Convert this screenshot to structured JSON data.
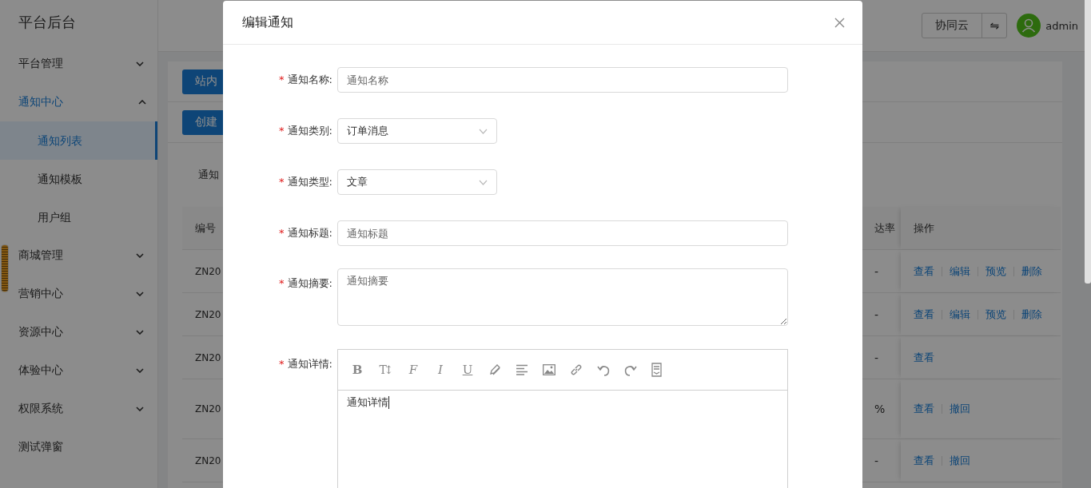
{
  "sidebar": {
    "title": "平台后台",
    "items": [
      {
        "label": "平台管理",
        "kind": "group",
        "selected": false,
        "expanded": false
      },
      {
        "label": "通知中心",
        "kind": "group",
        "selected": true,
        "expanded": true,
        "children": [
          {
            "label": "通知列表",
            "selected": true
          },
          {
            "label": "通知模板",
            "selected": false
          },
          {
            "label": "用户组",
            "selected": false
          }
        ]
      },
      {
        "label": "商城管理",
        "kind": "group",
        "selected": false,
        "expanded": false
      },
      {
        "label": "营销中心",
        "kind": "group",
        "selected": false,
        "expanded": false
      },
      {
        "label": "资源中心",
        "kind": "group",
        "selected": false,
        "expanded": false
      },
      {
        "label": "体验中心",
        "kind": "group",
        "selected": false,
        "expanded": false
      },
      {
        "label": "权限系统",
        "kind": "group",
        "selected": false,
        "expanded": false
      },
      {
        "label": "测试弹窗",
        "kind": "link",
        "selected": false
      }
    ]
  },
  "header": {
    "org": "协同云",
    "switch": "⇋",
    "user": "admin"
  },
  "toolbar": {
    "buttons": [
      "站内",
      "创建"
    ],
    "filter_label": "通知"
  },
  "table": {
    "columns": [
      "编号",
      "达率",
      "操作"
    ],
    "rows": [
      {
        "id": "ZN20",
        "rate": "-",
        "actions": [
          "查看",
          "编辑",
          "预览",
          "删除"
        ]
      },
      {
        "id": "ZN20",
        "rate": "-",
        "actions": [
          "查看",
          "编辑",
          "预览",
          "删除"
        ]
      },
      {
        "id": "ZN20",
        "rate": "-",
        "actions": [
          "查看"
        ]
      },
      {
        "id": "ZN20",
        "rate": "%",
        "actions": [
          "查看",
          "撤回"
        ]
      },
      {
        "id": "ZN20",
        "rate": "-",
        "actions": [
          "查看",
          "撤回"
        ]
      }
    ]
  },
  "modal": {
    "title": "编辑通知",
    "fields": [
      {
        "kind": "input",
        "required_mark": "*",
        "label": "通知名称:",
        "placeholder": "通知名称"
      },
      {
        "kind": "select",
        "required_mark": "*",
        "label": "通知类别:",
        "value": "订单消息"
      },
      {
        "kind": "select",
        "required_mark": "*",
        "label": "通知类型:",
        "value": "文章"
      },
      {
        "kind": "input",
        "required_mark": "*",
        "label": "通知标题:",
        "placeholder": "通知标题"
      },
      {
        "kind": "textarea",
        "required_mark": "*",
        "label": "通知摘要:",
        "placeholder": "通知摘要"
      },
      {
        "kind": "editor",
        "required_mark": "*",
        "label": "通知详情:",
        "value": "通知详情",
        "tools": [
          {
            "kind": "bold",
            "glyph": "B"
          },
          {
            "kind": "size",
            "glyph": "T↕"
          },
          {
            "kind": "font",
            "glyph": "F"
          },
          {
            "kind": "italic",
            "glyph": "I"
          },
          {
            "kind": "underline",
            "glyph": "U"
          },
          {
            "kind": "pen"
          },
          {
            "kind": "align"
          },
          {
            "kind": "image"
          },
          {
            "kind": "link"
          },
          {
            "kind": "undo"
          },
          {
            "kind": "redo"
          },
          {
            "kind": "doc"
          }
        ]
      }
    ]
  }
}
